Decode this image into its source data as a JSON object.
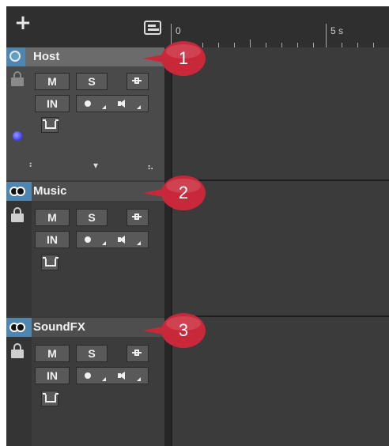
{
  "toolbar": {
    "add_icon": "plus-icon",
    "panel_icon": "panel-toggle-icon"
  },
  "ruler": {
    "start_label": "0",
    "mark_label": "5 s"
  },
  "tracks": [
    {
      "name": "Host",
      "channel": "mono",
      "mute_label": "M",
      "solo_label": "S",
      "input_label": "IN",
      "callout": "1"
    },
    {
      "name": "Music",
      "channel": "stereo",
      "mute_label": "M",
      "solo_label": "S",
      "input_label": "IN",
      "callout": "2"
    },
    {
      "name": "SoundFX",
      "channel": "stereo",
      "mute_label": "M",
      "solo_label": "S",
      "input_label": "IN",
      "callout": "3"
    }
  ],
  "colors": {
    "callout": "#c8283a",
    "channel_highlight": "#4f86b0",
    "background": "#2b2b2b"
  }
}
